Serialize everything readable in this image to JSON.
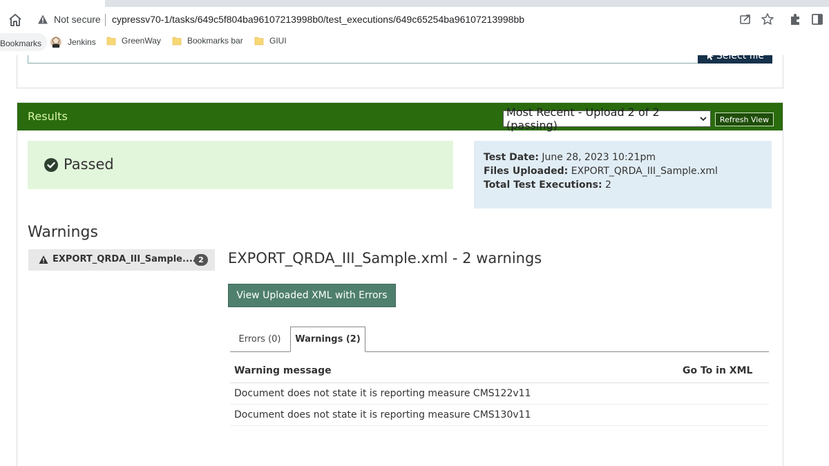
{
  "browser": {
    "security_label": "Not secure",
    "url": "cypressv70-1/tasks/649c5f804ba96107213998b0/test_executions/649c65254ba96107213998bb",
    "bookmarks": [
      {
        "label": "Bookmarks",
        "icon": "none"
      },
      {
        "label": "Jenkins",
        "icon": "jenkins-icon"
      },
      {
        "label": "GreenWay",
        "icon": "folder-icon"
      },
      {
        "label": "Bookmarks bar",
        "icon": "folder-icon"
      },
      {
        "label": "GIUI",
        "icon": "folder-icon"
      }
    ]
  },
  "upload": {
    "select_file_label": "Select file"
  },
  "results": {
    "title": "Results",
    "upload_selected": "Most Recent - Upload 2 of 2 (passing)",
    "refresh_label": "Refresh View",
    "status": "Passed",
    "info": {
      "test_date_label": "Test Date:",
      "test_date_value": "June 28, 2023 10:21pm",
      "files_uploaded_label": "Files Uploaded:",
      "files_uploaded_value": "EXPORT_QRDA_III_Sample.xml",
      "total_label": "Total Test Executions:",
      "total_value": "2"
    }
  },
  "warnings": {
    "heading": "Warnings",
    "file_nav": {
      "label": "EXPORT_QRDA_III_Sample....",
      "count": "2"
    },
    "detail_title": "EXPORT_QRDA_III_Sample.xml - 2 warnings",
    "view_xml_label": "View Uploaded XML with Errors",
    "tabs": {
      "errors": "Errors (0)",
      "warnings": "Warnings (2)"
    },
    "table": {
      "col_message": "Warning message",
      "col_goto": "Go To in XML",
      "rows": [
        "Document does not state it is reporting measure CMS122v11",
        "Document does not state it is reporting measure CMS130v11"
      ]
    }
  },
  "colors": {
    "results_header": "#2a6b0e",
    "passed_bg": "#e2f6dc",
    "info_bg": "#e1edf5",
    "view_xml_btn": "#4f806d"
  }
}
